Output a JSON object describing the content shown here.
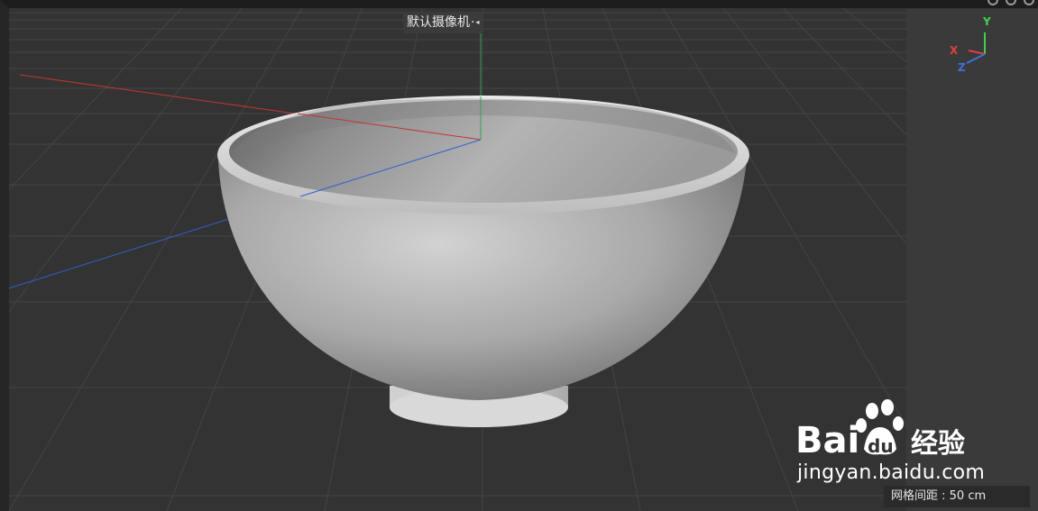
{
  "viewport": {
    "camera_label": "默认摄像机",
    "camera_suffix": "·",
    "camera_menu_glyph": "◂",
    "grid_spacing_label": "网格间距 : 50 cm"
  },
  "axis_gizmo": {
    "y_label": "Y",
    "x_label": "X",
    "z_label": "Z",
    "y_color": "#3fd24a",
    "x_color": "#e0403a",
    "z_color": "#3f6fe6"
  },
  "scene": {
    "object": "bowl-model",
    "world_axis_x_color": "#c8332d",
    "world_axis_y_color": "#29a84a",
    "world_axis_z_color": "#2f5fd6",
    "grid_color": "#444444"
  },
  "watermark": {
    "brand_text": "Bai",
    "brand_du": "du",
    "brand_cn": "经验",
    "url": "jingyan.baidu.com"
  }
}
